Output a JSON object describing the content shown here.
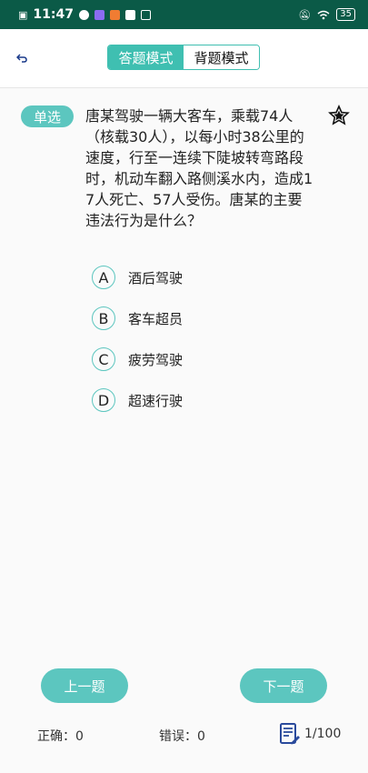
{
  "status_bar": {
    "time": "11:47",
    "battery": "35"
  },
  "header": {
    "back_icon": "back-arrow-icon",
    "modes": [
      {
        "label": "答题模式",
        "active": true
      },
      {
        "label": "背题模式",
        "active": false
      }
    ]
  },
  "question": {
    "type": "单选",
    "text": "唐某驾驶一辆大客车，乘载74人（核载30人），以每小时38公里的速度，行至一连续下陡坡转弯路段时，机动车翻入路侧溪水内，造成17人死亡、57人受伤。唐某的主要违法行为是什么？",
    "options": [
      {
        "key": "A",
        "text": "酒后驾驶"
      },
      {
        "key": "B",
        "text": "客车超员"
      },
      {
        "key": "C",
        "text": "疲劳驾驶"
      },
      {
        "key": "D",
        "text": "超速行驶"
      }
    ]
  },
  "nav": {
    "prev": "上一题",
    "next": "下一题"
  },
  "footer": {
    "correct_label": "正确：",
    "correct_count": "0",
    "wrong_label": "错误：",
    "wrong_count": "0",
    "progress": "1/100"
  },
  "colors": {
    "accent": "#5cc6bf",
    "toggle_border": "#3fbfb1",
    "status_bar": "#0b5a47"
  }
}
